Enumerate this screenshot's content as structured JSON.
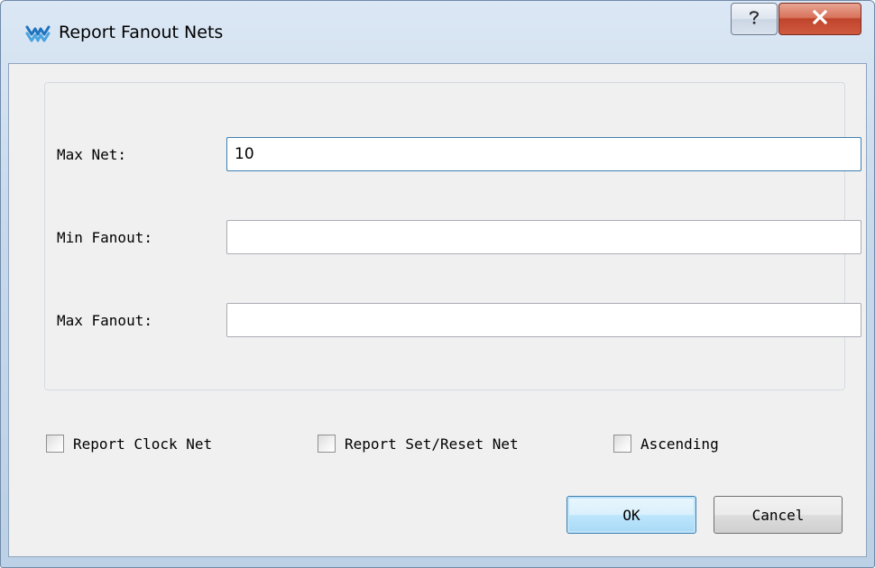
{
  "window": {
    "title": "Report Fanout Nets",
    "help_glyph": "?",
    "close_glyph": "X"
  },
  "fields": {
    "max_net": {
      "label": "Max Net:",
      "value": "10",
      "placeholder": ""
    },
    "min_fanout": {
      "label": "Min Fanout:",
      "value": "",
      "placeholder": ""
    },
    "max_fanout": {
      "label": "Max Fanout:",
      "value": "",
      "placeholder": ""
    }
  },
  "checkboxes": [
    {
      "label": "Report Clock Net",
      "checked": false
    },
    {
      "label": "Report Set/Reset Net",
      "checked": false
    },
    {
      "label": "Ascending",
      "checked": false
    }
  ],
  "buttons": {
    "ok_label": "OK",
    "cancel_label": "Cancel"
  },
  "colors": {
    "accent": "#3c7fb1",
    "close_red": "#c0442c",
    "app_icon": "#1e73be"
  },
  "icons": {
    "app": "fanout-app-icon",
    "help": "help-icon",
    "close": "close-icon"
  }
}
